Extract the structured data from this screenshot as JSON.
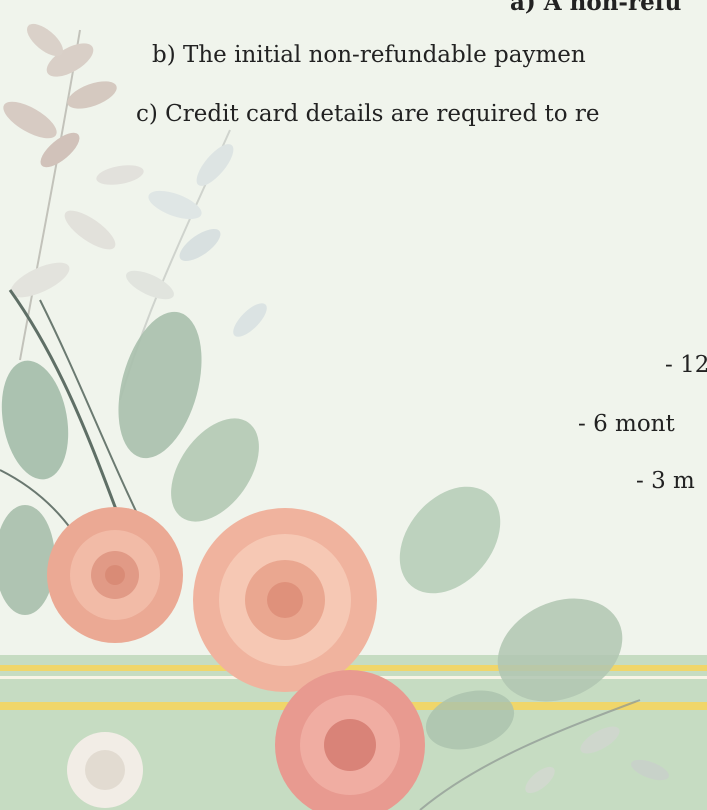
{
  "policy": {
    "line_a": "a) A non-refu",
    "line_b": "b) The initial non-refundable paymen",
    "line_c": "c) Credit card details are required to re"
  },
  "plans": {
    "p12": "- 12",
    "p6": "- 6 mont",
    "p3": "- 3 m"
  },
  "colors": {
    "background": "#f0f4ec",
    "band": "#c6dcc2",
    "gold_stripe": "#f0d66a",
    "rose": "#eeaa98",
    "leaf": "#a9c4ae"
  }
}
